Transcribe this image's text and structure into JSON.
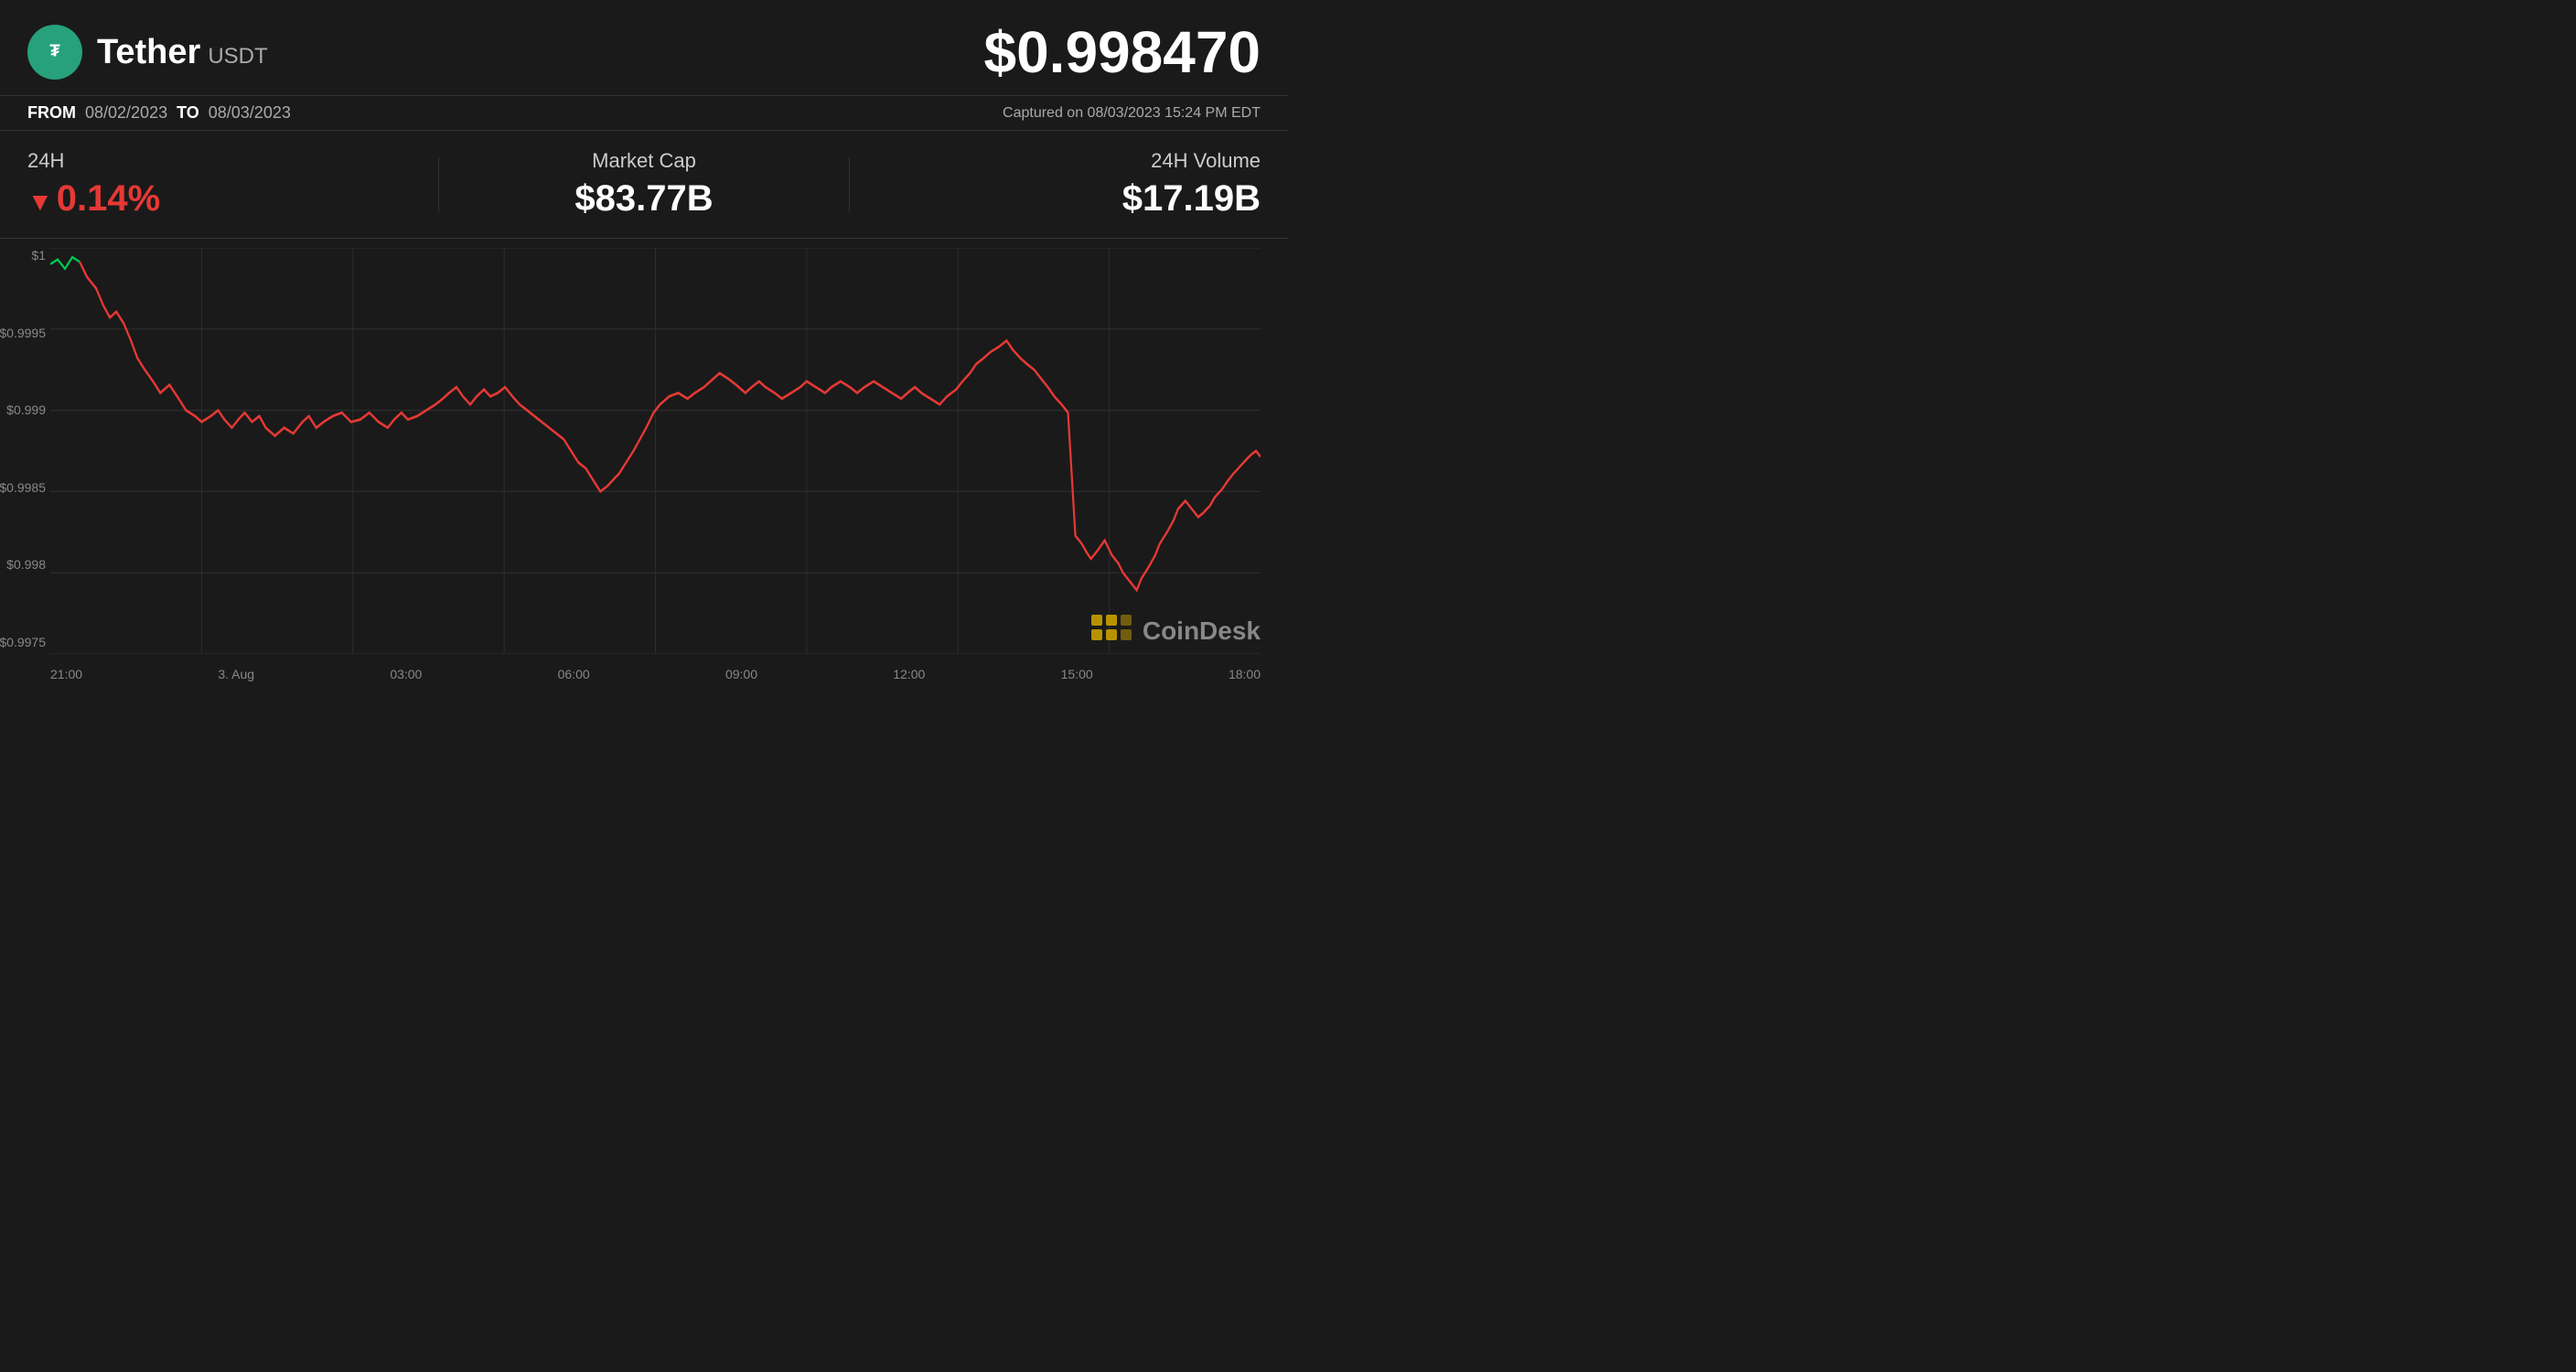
{
  "header": {
    "coin_name": "Tether",
    "coin_symbol": "USDT",
    "current_price": "$0.998470",
    "capture_info": "Captured on 08/03/2023 15:24 PM EDT"
  },
  "date_range": {
    "from_label": "FROM",
    "from_date": "08/02/2023",
    "to_label": "TO",
    "to_date": "08/03/2023"
  },
  "stats": {
    "change_label": "24H",
    "change_value": "0.14%",
    "change_direction": "down",
    "market_cap_label": "Market Cap",
    "market_cap_value": "$83.77B",
    "volume_label": "24H Volume",
    "volume_value": "$17.19B"
  },
  "chart": {
    "y_labels": [
      "$1",
      "$0.9995",
      "$0.999",
      "$0.9985",
      "$0.998",
      "$0.9975"
    ],
    "x_labels": [
      "21:00",
      "3. Aug",
      "03:00",
      "06:00",
      "09:00",
      "12:00",
      "15:00",
      "18:00"
    ]
  },
  "watermark": {
    "text": "CoinDesk"
  }
}
